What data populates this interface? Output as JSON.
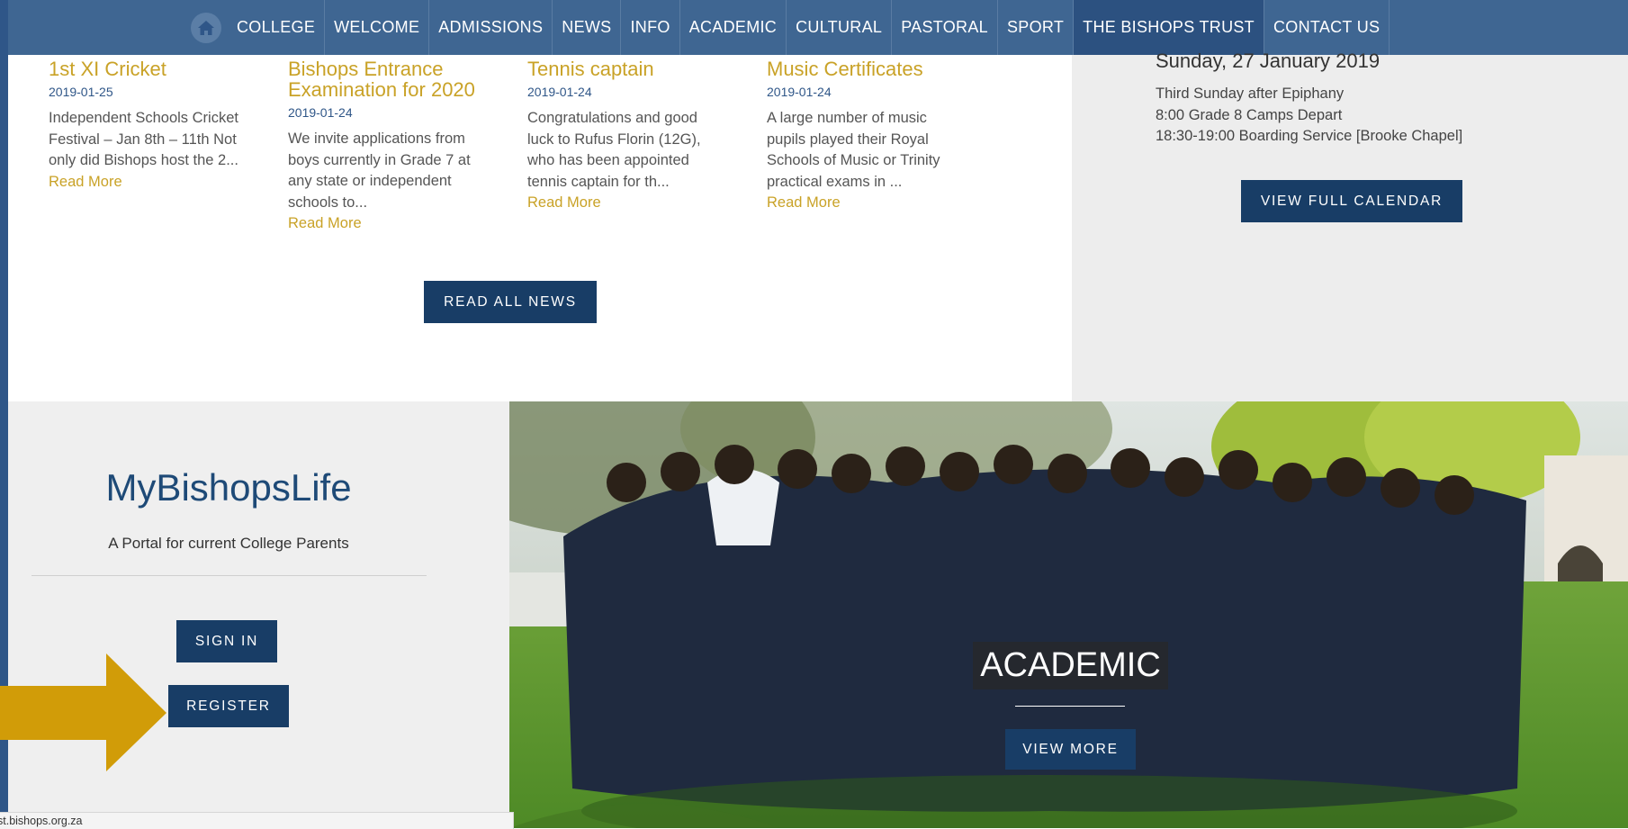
{
  "nav": {
    "items": [
      "COLLEGE",
      "WELCOME",
      "ADMISSIONS",
      "NEWS",
      "INFO",
      "ACADEMIC",
      "CULTURAL",
      "PASTORAL",
      "SPORT",
      "THE BISHOPS TRUST",
      "CONTACT US"
    ],
    "active": "THE BISHOPS TRUST",
    "home_icon": "home-icon"
  },
  "news": {
    "items": [
      {
        "title": "1st XI Cricket",
        "date": "2019-01-25",
        "excerpt": "Independent Schools Cricket Festival – Jan 8th – 11th Not only did Bishops host the 2...",
        "more": "Read More"
      },
      {
        "title": "Bishops Entrance Examination for 2020",
        "date": "2019-01-24",
        "excerpt": "We invite applications from boys currently in Grade 7 at any state or independent schools to...",
        "more": "Read More"
      },
      {
        "title": "Tennis captain",
        "date": "2019-01-24",
        "excerpt": "Congratulations and good luck to Rufus Florin (12G), who has been appointed tennis captain for th...",
        "more": "Read More"
      },
      {
        "title": "Music Certificates",
        "date": "2019-01-24",
        "excerpt": "A large number of music pupils played their Royal Schools of Music or Trinity practical exams in ...",
        "more": "Read More"
      }
    ],
    "read_all": "READ ALL NEWS"
  },
  "calendar": {
    "date": "Sunday, 27 January 2019",
    "events": [
      "Third Sunday after Epiphany",
      "8:00 Grade 8 Camps Depart",
      "18:30-19:00 Boarding Service [Brooke Chapel]"
    ],
    "button": "VIEW FULL CALENDAR"
  },
  "mybishopslife": {
    "title": "MyBishopsLife",
    "subtitle": "A Portal for current College Parents",
    "sign_in": "SIGN IN",
    "register": "REGISTER"
  },
  "hero": {
    "label": "ACADEMIC",
    "button": "VIEW MORE"
  },
  "statusbar": {
    "url": "st.bishops.org.za"
  },
  "colors": {
    "nav_bg": "#3f6692",
    "button_bg": "#183d66",
    "accent_gold": "#c9a227",
    "arrow": "#d19c08"
  }
}
